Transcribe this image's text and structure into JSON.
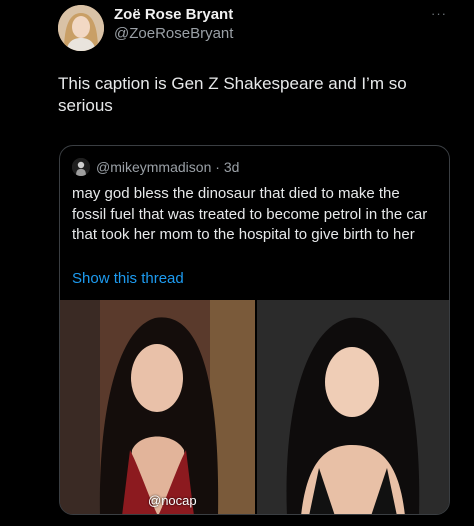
{
  "author": {
    "name": "Zoë Rose Bryant",
    "handle": "@ZoeRoseBryant",
    "avatar_icon": "profile-photo"
  },
  "more_label": "···",
  "caption": "This caption is Gen Z Shakespeare and I’m so serious",
  "quote": {
    "handle": "@mikeymmadison",
    "separator": "·",
    "time": "3d",
    "text": "may god bless the dinosaur that died to make the fossil fuel that was treated to become petrol in the car that took her mom to the hospital to give birth to her",
    "show_thread_label": "Show this thread",
    "photo_watermark": "@nocap",
    "colors": {
      "link": "#1d9bf0",
      "muted": "#9aa0a6",
      "border": "#3a3e42"
    }
  }
}
